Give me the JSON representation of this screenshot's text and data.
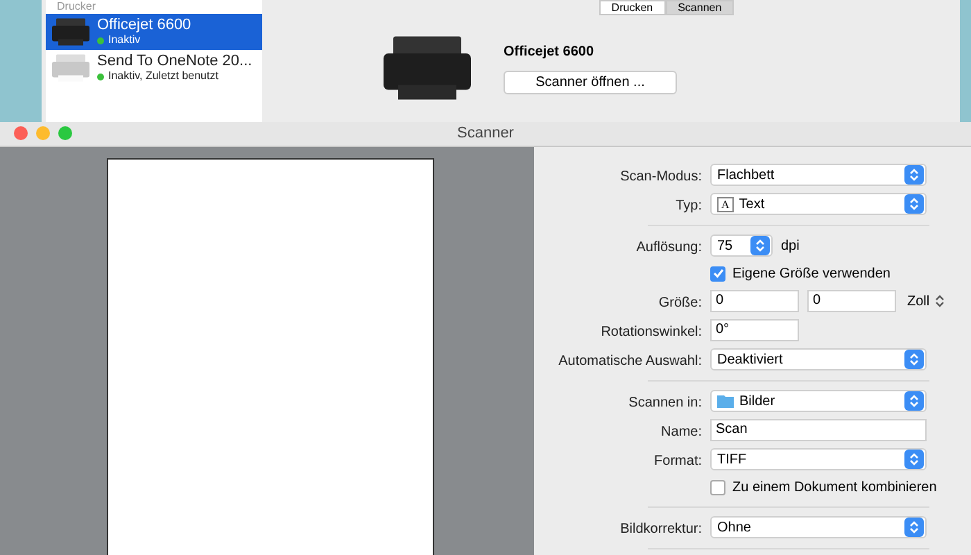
{
  "printers_window": {
    "sidebar": {
      "header": "Drucker",
      "items": [
        {
          "name": "Officejet 6600",
          "status": "Inaktiv",
          "selected": true,
          "color": "#3cc13c"
        },
        {
          "name": "Send To OneNote 20...",
          "status": "Inaktiv, Zuletzt benutzt",
          "selected": false,
          "color": "#3cc13c"
        }
      ]
    },
    "tabs": [
      {
        "label": "Drucken",
        "selected": false
      },
      {
        "label": "Scannen",
        "selected": true
      }
    ],
    "printer_name": "Officejet 6600",
    "open_button": "Scanner öffnen ..."
  },
  "scanner_window": {
    "title": "Scanner",
    "rows": [
      {
        "kind": "select",
        "label": "Scan-Modus:",
        "value": "Flachbett"
      },
      {
        "kind": "select",
        "label": "Typ:",
        "value": "Text",
        "icon": "A"
      },
      {
        "kind": "separator"
      },
      {
        "kind": "stepper",
        "label": "Auflösung:",
        "value": "75",
        "unit": "dpi"
      },
      {
        "kind": "checkbox",
        "text": "Eigene Größe verwenden",
        "checked": true
      },
      {
        "kind": "size",
        "label": "Größe:",
        "value": "0",
        "value_2": "0",
        "unit": "Zoll"
      },
      {
        "kind": "short_text",
        "label": "Rotationswinkel:",
        "value": "0°"
      },
      {
        "kind": "select",
        "label": "Automatische Auswahl:",
        "value": "Deaktiviert"
      },
      {
        "kind": "separator"
      },
      {
        "kind": "folder",
        "label": "Scannen in:",
        "value": "Bilder"
      },
      {
        "kind": "text",
        "label": "Name:",
        "value": "Scan"
      },
      {
        "kind": "select",
        "label": "Format:",
        "value": "TIFF"
      },
      {
        "kind": "checkbox",
        "text": "Zu einem Dokument kombinieren",
        "checked": false
      },
      {
        "kind": "separator"
      },
      {
        "kind": "select",
        "label": "Bildkorrektur:",
        "value": "Ohne"
      },
      {
        "kind": "separator"
      }
    ]
  }
}
